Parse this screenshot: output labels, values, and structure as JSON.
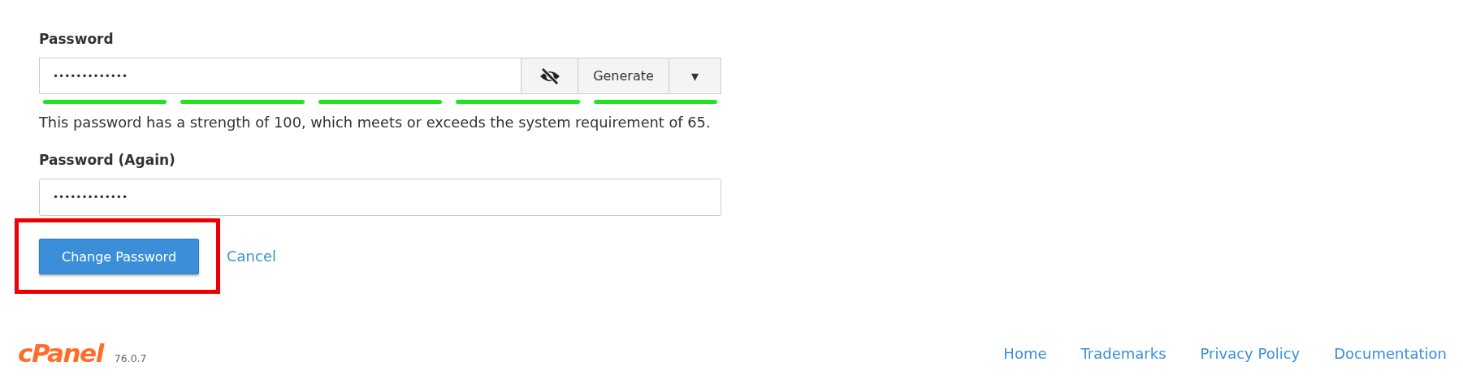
{
  "password": {
    "label": "Password",
    "value": "•••••••••••••",
    "reveal": false,
    "generate_label": "Generate",
    "caret": "▾"
  },
  "strength": {
    "segments": [
      {
        "filled": true
      },
      {
        "filled": true
      },
      {
        "filled": true
      },
      {
        "filled": true
      },
      {
        "filled": true
      }
    ],
    "message": "This password has a strength of 100, which meets or exceeds the system requirement of 65."
  },
  "password_again": {
    "label": "Password (Again)",
    "value": "•••••••••••••"
  },
  "submit_button": {
    "label": "Change Password",
    "highlighted": true
  },
  "cancel_link": "Cancel",
  "footer": {
    "logo": "cPanel",
    "version": "76.0.7",
    "links": [
      "Home",
      "Trademarks",
      "Privacy Policy",
      "Documentation"
    ]
  }
}
